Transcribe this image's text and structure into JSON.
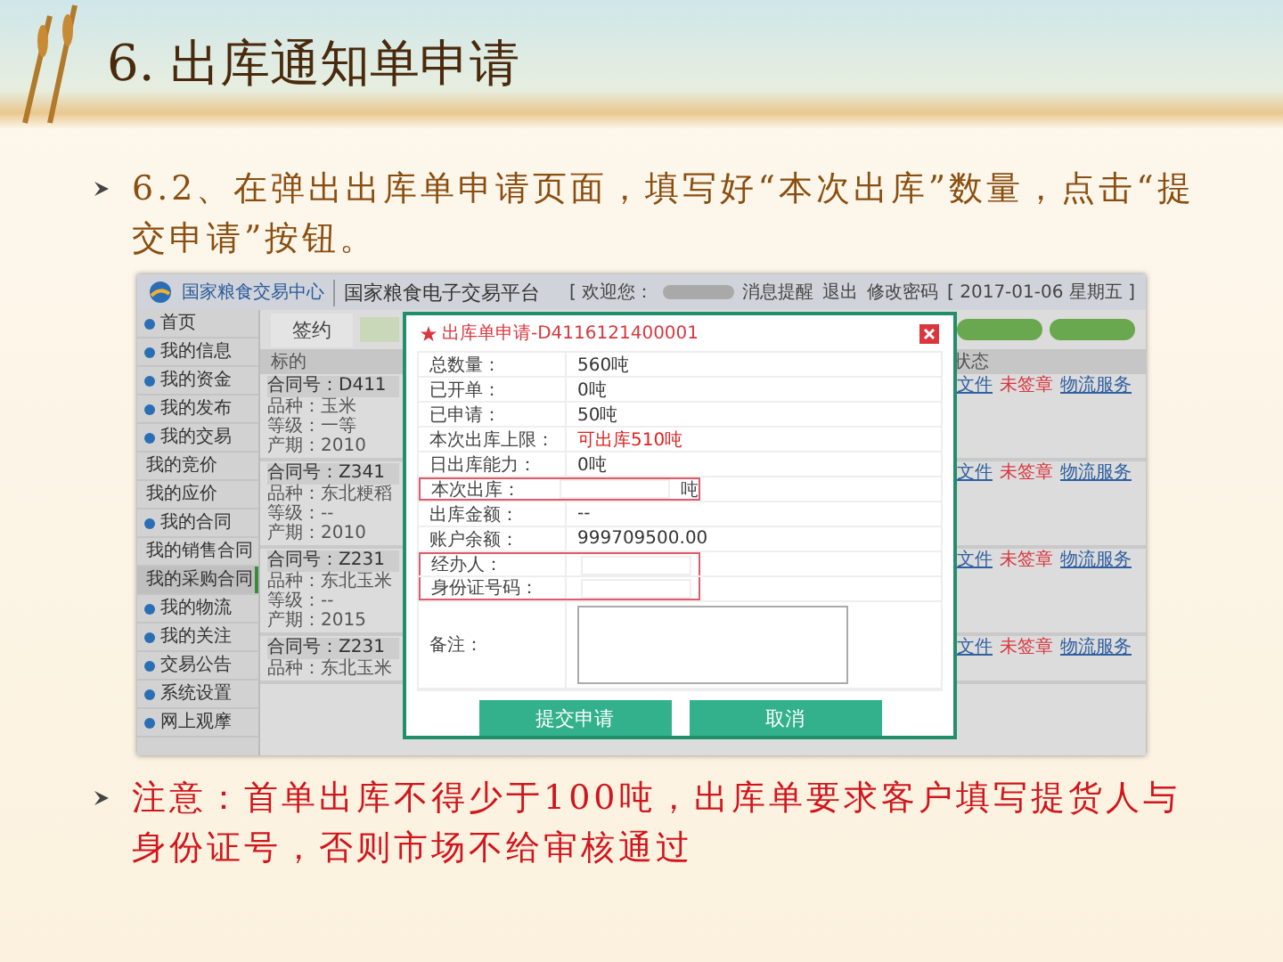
{
  "slide": {
    "title": "6. 出库通知单申请"
  },
  "bullets": [
    {
      "kind": "step",
      "text": "6.2、在弹出出库单申请页面，填写好“本次出库”数量，点击“提交申请”按钮。"
    },
    {
      "kind": "note",
      "text": "注意：首单出库不得少于100吨，出库单要求客户填写提货人与身份证号，否则市场不给审核通过"
    }
  ],
  "screenshot": {
    "header": {
      "org": "国家粮食交易中心",
      "platform": "国家粮食电子交易平台",
      "welcome": "[ 欢迎您：",
      "links": [
        "消息提醒",
        "退出",
        "修改密码"
      ],
      "date": "[ 2017-01-06 星期五 ]"
    },
    "sidebar": [
      {
        "label": "首页",
        "selected": false
      },
      {
        "label": "我的信息",
        "selected": false
      },
      {
        "label": "我的资金",
        "selected": false
      },
      {
        "label": "我的发布",
        "selected": false
      },
      {
        "label": "我的交易",
        "selected": false,
        "children": [
          {
            "label": "我的竞价",
            "selected": false
          },
          {
            "label": "我的应价",
            "selected": false
          }
        ]
      },
      {
        "label": "我的合同",
        "selected": false,
        "children": [
          {
            "label": "我的销售合同",
            "selected": false
          },
          {
            "label": "我的采购合同",
            "selected": true
          }
        ]
      },
      {
        "label": "我的物流",
        "selected": false
      },
      {
        "label": "我的关注",
        "selected": false
      },
      {
        "label": "交易公告",
        "selected": false
      },
      {
        "label": "系统设置",
        "selected": false
      },
      {
        "label": "网上观摩",
        "selected": false
      }
    ],
    "tabs": [
      {
        "label": "签约",
        "selected": false
      }
    ],
    "columns": [
      "标的",
      "状态"
    ],
    "contracts": [
      {
        "number": "合同号：D411",
        "lines": [
          "品种：玉米",
          "等级：一等",
          "产期：2010"
        ],
        "status": [
          "文件",
          "未签章",
          "物流服务"
        ]
      },
      {
        "number": "合同号：Z341",
        "lines": [
          "品种：东北粳稻",
          "等级：--",
          "产期：2010"
        ],
        "status": [
          "文件",
          "未签章",
          "物流服务"
        ]
      },
      {
        "number": "合同号：Z231",
        "lines": [
          "品种：东北玉米",
          "等级：--",
          "产期：2015"
        ],
        "status": [
          "文件",
          "未签章",
          "物流服务"
        ]
      },
      {
        "number": "合同号：Z231",
        "lines": [
          "品种：东北玉米"
        ],
        "status": [
          "文件",
          "未签章",
          "物流服务"
        ]
      }
    ]
  },
  "modal": {
    "title": "出库单申请-D4116121400001",
    "fields": [
      {
        "label": "总数量：",
        "value": "560吨",
        "kind": "text",
        "highlighted": false
      },
      {
        "label": "已开单：",
        "value": "0吨",
        "kind": "text",
        "highlighted": false
      },
      {
        "label": "已申请：",
        "value": "50吨",
        "kind": "text",
        "highlighted": false
      },
      {
        "label": "本次出库上限：",
        "value": "可出库510吨",
        "kind": "warn",
        "highlighted": false
      },
      {
        "label": "日出库能力：",
        "value": "0吨",
        "kind": "text",
        "highlighted": false
      },
      {
        "label": "本次出库：",
        "unit": "吨",
        "kind": "input",
        "highlighted": true
      },
      {
        "label": "出库金额：",
        "value": "--",
        "kind": "text",
        "highlighted": false
      },
      {
        "label": "账户余额：",
        "value": "999709500.00",
        "kind": "text",
        "highlighted": false
      },
      {
        "label": "经办人：",
        "kind": "input",
        "highlighted": true
      },
      {
        "label": "身份证号码：",
        "kind": "input",
        "highlighted": true
      },
      {
        "label": "备注：",
        "kind": "textarea",
        "highlighted": false
      }
    ],
    "buttons": [
      "提交申请",
      "取消"
    ]
  }
}
